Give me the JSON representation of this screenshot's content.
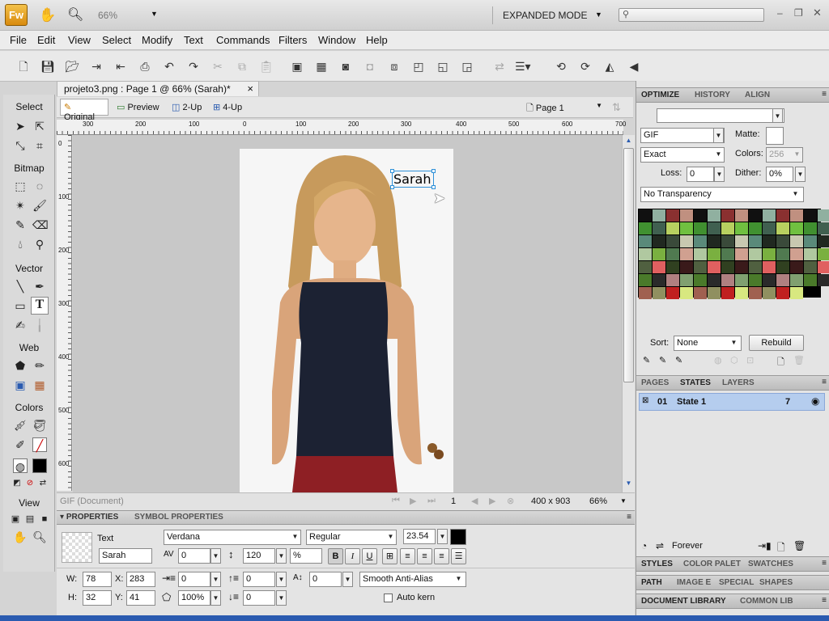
{
  "titlebar": {
    "logo": "Fw",
    "zoom": "66%",
    "mode": "EXPANDED MODE",
    "search_placeholder": ""
  },
  "menu": [
    "File",
    "Edit",
    "View",
    "Select",
    "Modify",
    "Text",
    "Commands",
    "Filters",
    "Window",
    "Help"
  ],
  "doc": {
    "tab_title": "projeto3.png : Page 1 @ 66% (Sarah)*",
    "close": "×"
  },
  "viewbar": {
    "original": "Original",
    "preview": "Preview",
    "two_up": "2-Up",
    "four_up": "4-Up",
    "page": "Page 1"
  },
  "tools": {
    "select": "Select",
    "bitmap": "Bitmap",
    "vector": "Vector",
    "web": "Web",
    "colors": "Colors",
    "view": "View"
  },
  "ruler": {
    "h_ticks": [
      "300",
      "200",
      "100",
      "0",
      "100",
      "200",
      "300",
      "400",
      "500",
      "600",
      "700"
    ],
    "v_ticks": [
      "0",
      "100",
      "200",
      "300",
      "400",
      "500",
      "600"
    ]
  },
  "canvas": {
    "text_object": "Sarah"
  },
  "status": {
    "format": "GIF (Document)",
    "frame": "1",
    "size": "400 x 903",
    "zoom": "66%"
  },
  "properties": {
    "tab1": "PROPERTIES",
    "tab2": "SYMBOL PROPERTIES",
    "type": "Text",
    "name": "Sarah",
    "font": "Verdana",
    "style": "Regular",
    "size": "23.54",
    "kerning": "0",
    "leading": "120",
    "leading_unit": "%",
    "w_label": "W:",
    "w": "78",
    "x_label": "X:",
    "x": "283",
    "h_label": "H:",
    "h": "32",
    "y_label": "Y:",
    "y": "41",
    "indent": "0",
    "space_before": "0",
    "baseline": "0",
    "horiz_scale": "100%",
    "space_after": "0",
    "antialias": "Smooth Anti-Alias",
    "autokern": "Auto kern",
    "bold": "B",
    "italic": "I",
    "underline": "U"
  },
  "right": {
    "tabs1": [
      "OPTIMIZE",
      "HISTORY",
      "ALIGN"
    ],
    "format": "GIF",
    "matte_label": "Matte:",
    "palette": "Exact",
    "colors_label": "Colors:",
    "colors": "256",
    "loss_label": "Loss:",
    "loss": "0",
    "dither_label": "Dither:",
    "dither": "0%",
    "transparency": "No Transparency",
    "sort_label": "Sort:",
    "sort": "None",
    "rebuild": "Rebuild",
    "tabs2": [
      "PAGES",
      "STATES",
      "LAYERS"
    ],
    "state": {
      "num": "01",
      "name": "State 1",
      "delay": "7"
    },
    "forever": "Forever",
    "tabs3": [
      "STYLES",
      "COLOR PALET",
      "SWATCHES"
    ],
    "tabs4": [
      "PATH",
      "IMAGE E",
      "SPECIAL",
      "SHAPES"
    ],
    "tabs5": [
      "DOCUMENT LIBRARY",
      "COMMON LIB"
    ]
  },
  "colors": {
    "accent": "#2a5bb0",
    "selection": "#b5cdee",
    "fw_orange": "#e8a021"
  }
}
